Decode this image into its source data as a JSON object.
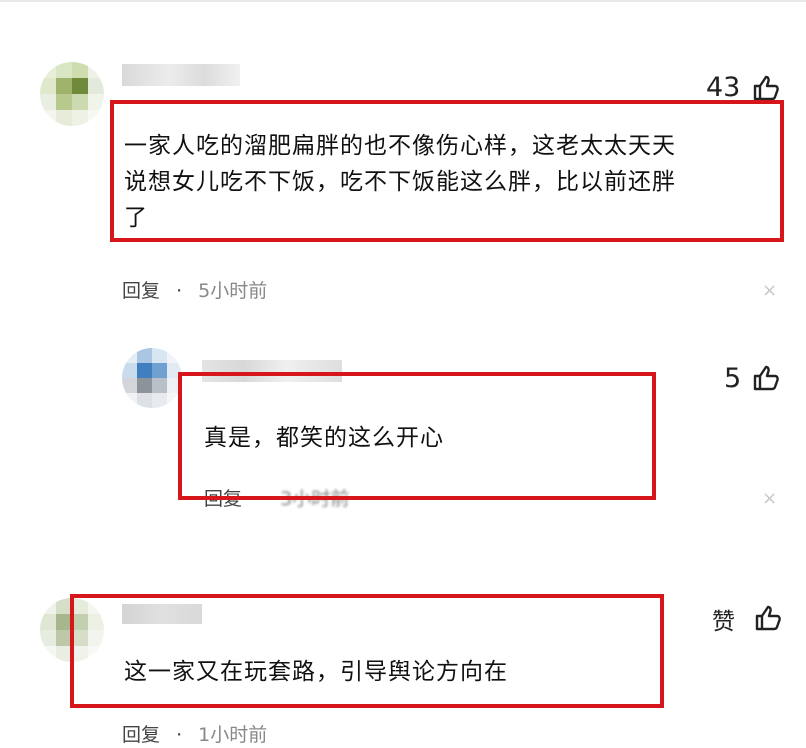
{
  "colors": {
    "highlight_border": "#d7161c",
    "text": "#111111",
    "meta": "#444444",
    "time": "#888888"
  },
  "comments": [
    {
      "likes": "43",
      "text_lines": [
        "一家人吃的溜肥扁胖的也不像伤心样，这老太太天天",
        "说想女儿吃不下饭，吃不下饭能这么胖，比以前还胖",
        "了"
      ],
      "reply_label": "回复",
      "separator": "·",
      "time": "5小时前",
      "close": "×",
      "thumb_icon": "thumb-up-icon"
    },
    {
      "likes": "5",
      "text": "真是，都笑的这么开心",
      "reply_label": "回复",
      "separator": "·",
      "time": "3小时前",
      "close": "×",
      "thumb_icon": "thumb-up-icon"
    },
    {
      "likes": "赞",
      "text": "这一家又在玩套路，引导舆论方向在",
      "reply_label": "回复",
      "separator": "·",
      "time": "1小时前",
      "thumb_icon": "thumb-up-icon"
    }
  ]
}
